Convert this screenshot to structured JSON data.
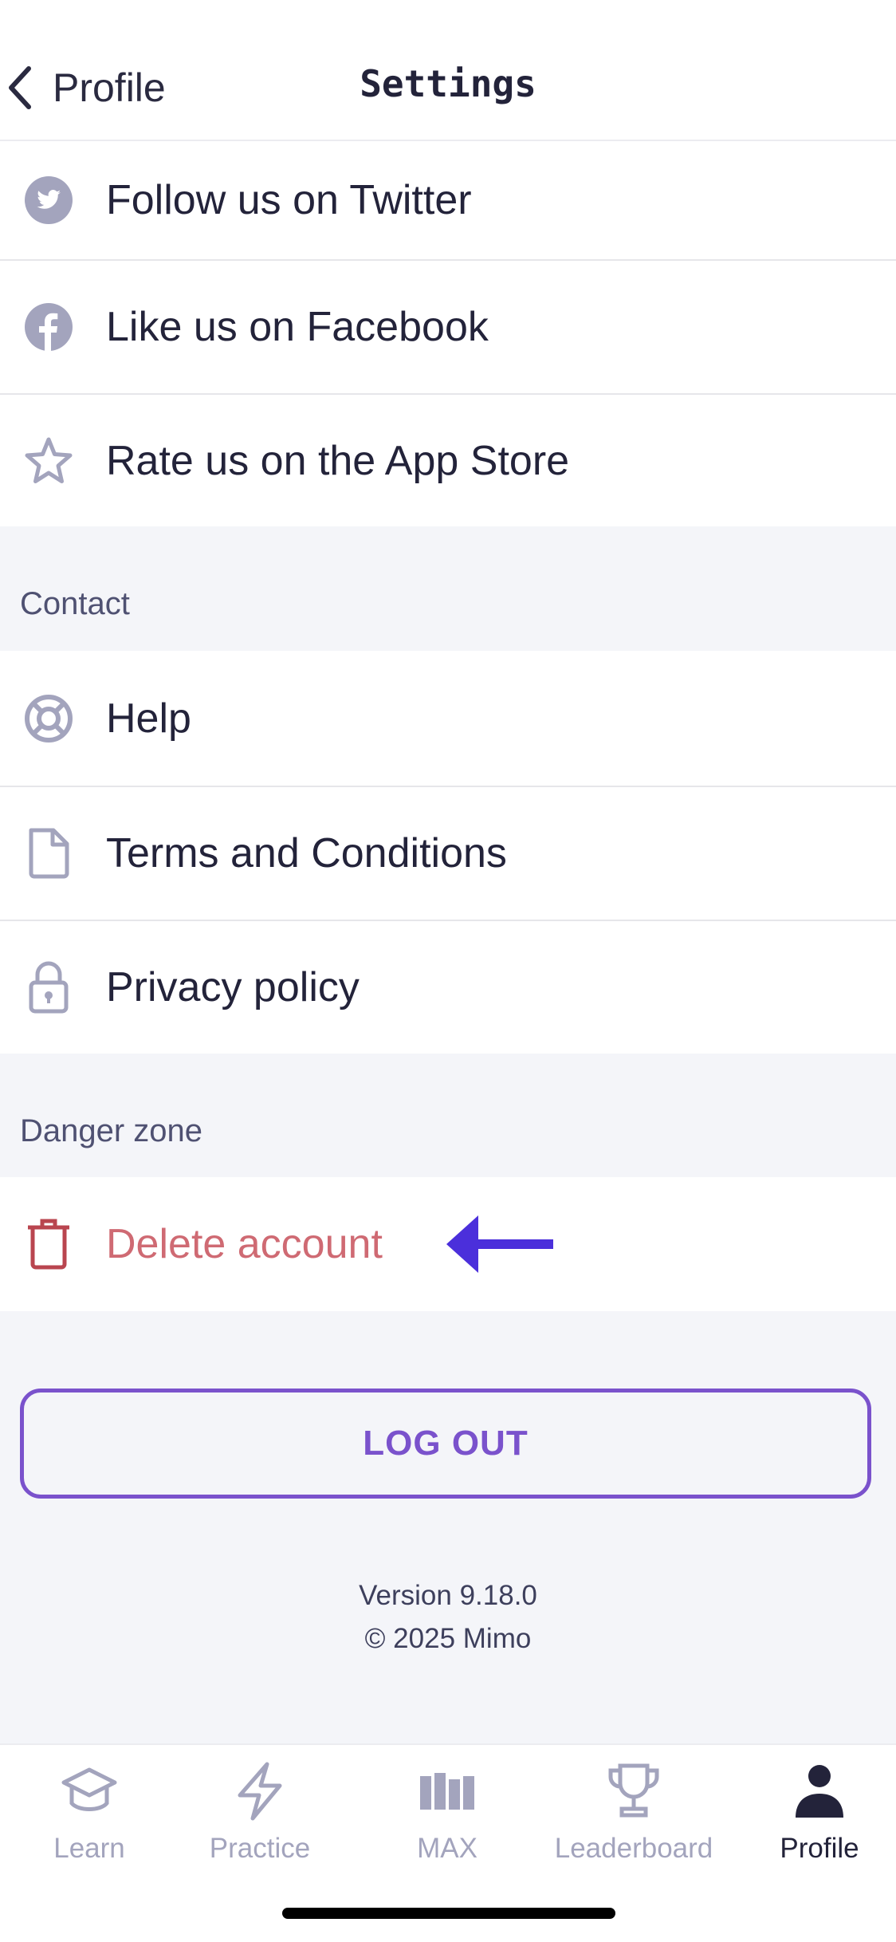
{
  "header": {
    "back_label": "Profile",
    "title": "Settings"
  },
  "social": [
    {
      "label": "Follow us on Twitter",
      "icon": "twitter-icon"
    },
    {
      "label": "Like us on Facebook",
      "icon": "facebook-icon"
    },
    {
      "label": "Rate us on the App Store",
      "icon": "star-icon"
    }
  ],
  "contact": {
    "heading": "Contact",
    "items": [
      {
        "label": "Help",
        "icon": "lifebuoy-icon"
      },
      {
        "label": "Terms and Conditions",
        "icon": "document-icon"
      },
      {
        "label": "Privacy policy",
        "icon": "lock-icon"
      }
    ]
  },
  "danger": {
    "heading": "Danger zone",
    "delete_label": "Delete account",
    "icon": "trash-icon",
    "annotation_icon": "arrow-left-icon"
  },
  "logout_label": "LOG OUT",
  "footer": {
    "version": "Version 9.18.0",
    "copyright": "© 2025 Mimo"
  },
  "tabs": [
    {
      "label": "Learn",
      "icon": "graduation-cap-icon",
      "active": false
    },
    {
      "label": "Practice",
      "icon": "lightning-icon",
      "active": false
    },
    {
      "label": "MAX",
      "icon": "max-icon",
      "active": false
    },
    {
      "label": "Leaderboard",
      "icon": "trophy-icon",
      "active": false
    },
    {
      "label": "Profile",
      "icon": "person-icon",
      "active": true
    }
  ],
  "colors": {
    "accent": "#7a52cc",
    "danger": "#cf6a73",
    "annotation_arrow": "#4b2fdb",
    "icon_gray": "#a3a4bd",
    "background": "#f4f5f9"
  }
}
